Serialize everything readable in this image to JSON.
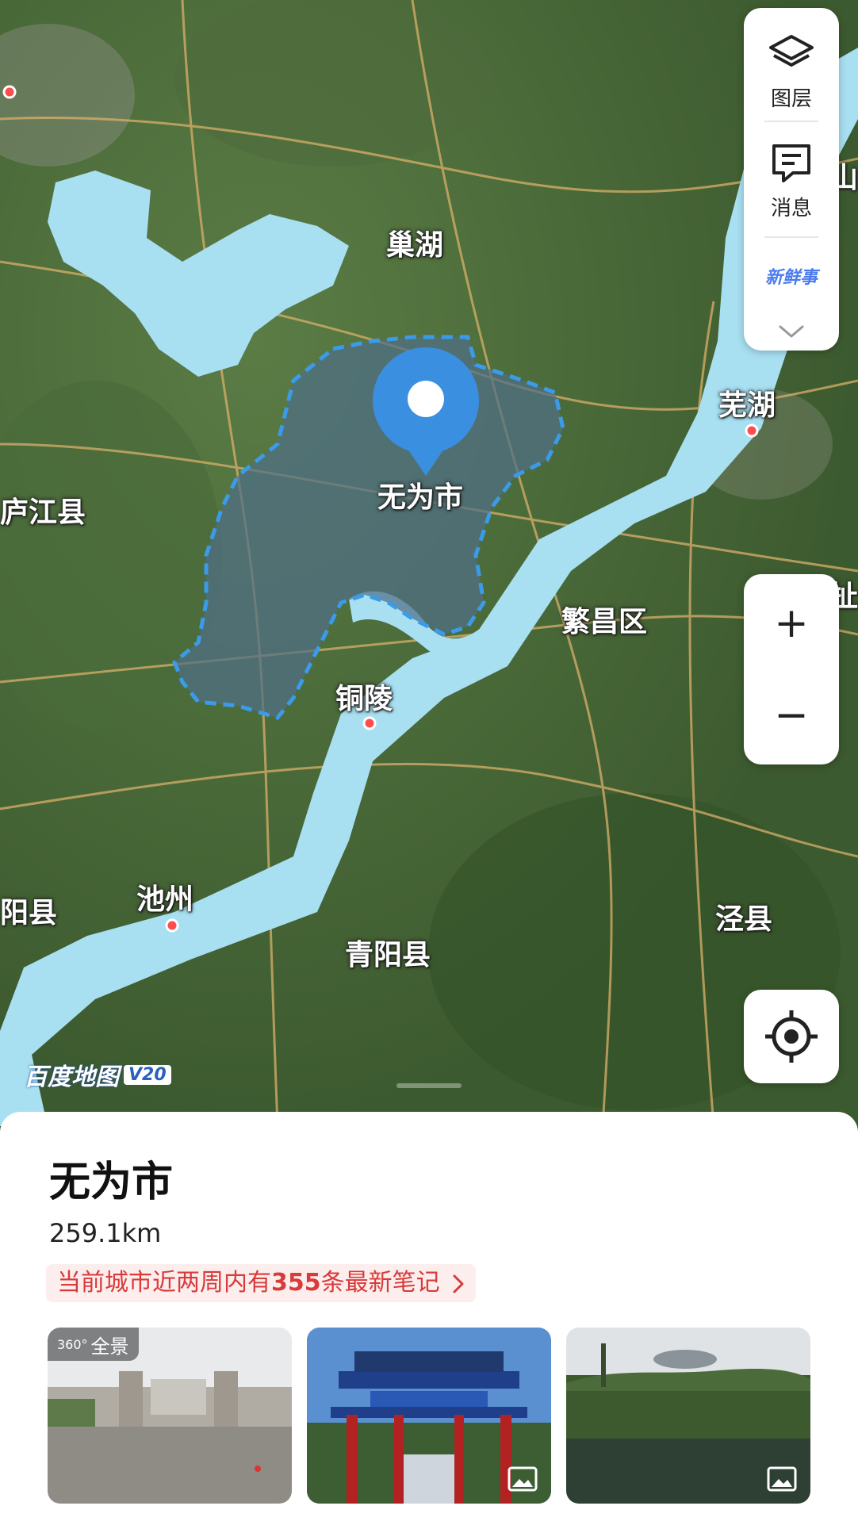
{
  "map": {
    "labels": {
      "chaohu": "巢湖",
      "lujiang": "庐江县",
      "wuweishi": "无为市",
      "wuhu": "芜湖",
      "fanchang": "繁昌区",
      "tongling": "铜陵",
      "chizhou": "池州",
      "yangxian": "阳县",
      "qingyang": "青阳县",
      "jingxian": "泾县",
      "edge_top": "山",
      "edge_mid": "扯"
    },
    "watermark_brand": "百度地图",
    "watermark_version": "V20"
  },
  "controls": {
    "layers_label": "图层",
    "messages_label": "消息",
    "fresh_badge": "新鲜事",
    "zoom_in": "+",
    "zoom_out": "−",
    "expand_icon": "chevron-down-icon",
    "locate_icon": "locate-icon"
  },
  "place": {
    "name": "无为市",
    "distance": "259.1km",
    "notes_prefix": "当前城市近两周内有",
    "notes_count": "355",
    "notes_suffix": "条最新笔记",
    "panorama_tag": "全景",
    "panorama_degrees": "360°"
  },
  "colors": {
    "water": "#a8e0f2",
    "district_fill": "#4f6f86",
    "district_border": "#3b9be8",
    "pin": "#3b8fe0",
    "city_dot": "#ff4d4d",
    "notes_text": "#d93a3a",
    "notes_bg": "#fdeeee"
  }
}
